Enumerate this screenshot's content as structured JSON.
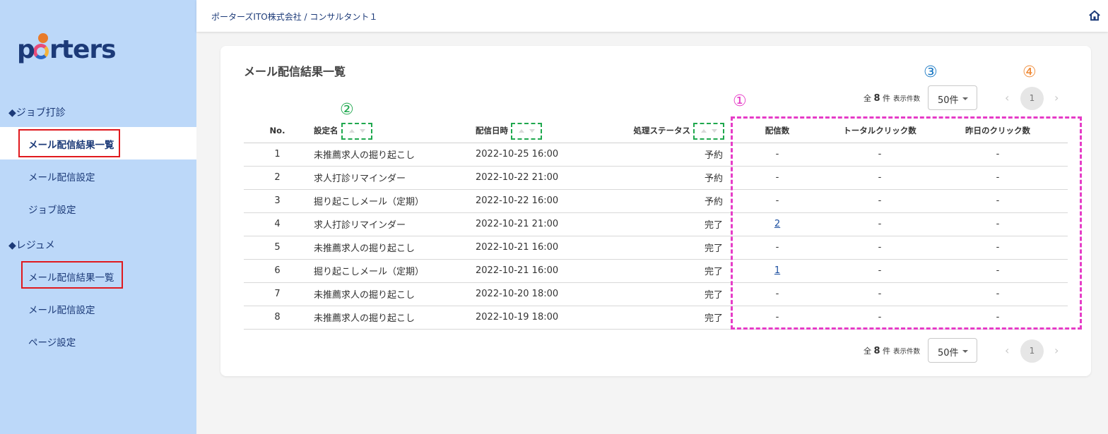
{
  "sidebar": {
    "logo_text": "porters",
    "sections": [
      {
        "heading": "◆ジョブ打診",
        "items": [
          "メール配信結果一覧",
          "メール配信設定",
          "ジョブ設定"
        ]
      },
      {
        "heading": "◆レジュメ",
        "items": [
          "メール配信結果一覧",
          "メール配信設定",
          "ページ設定"
        ]
      }
    ]
  },
  "header": {
    "breadcrumb": "ポーターズITO株式会社 / コンサルタント１"
  },
  "main": {
    "title": "メール配信結果一覧",
    "pager": {
      "total_prefix": "全",
      "total_count": "8",
      "total_suffix": "件",
      "per_page_label": "表示件数",
      "per_page_value": "50件",
      "prev": "‹",
      "current_page": "1",
      "next": "›"
    },
    "columns": [
      "No.",
      "設定名",
      "配信日時",
      "処理ステータス",
      "配信数",
      "トータルクリック数",
      "昨日のクリック数"
    ],
    "rows": [
      [
        "1",
        "未推薦求人の掘り起こし",
        "2022-10-25 16:00",
        "予約",
        "-",
        "-",
        "-"
      ],
      [
        "2",
        "求人打診リマインダー",
        "2022-10-22 21:00",
        "予約",
        "-",
        "-",
        "-"
      ],
      [
        "3",
        "掘り起こしメール（定期）",
        "2022-10-22 16:00",
        "予約",
        "-",
        "-",
        "-"
      ],
      [
        "4",
        "求人打診リマインダー",
        "2022-10-21 21:00",
        "完了",
        "2",
        "-",
        "-"
      ],
      [
        "5",
        "未推薦求人の掘り起こし",
        "2022-10-21 16:00",
        "完了",
        "-",
        "-",
        "-"
      ],
      [
        "6",
        "掘り起こしメール（定期）",
        "2022-10-21 16:00",
        "完了",
        "1",
        "-",
        "-"
      ],
      [
        "7",
        "未推薦求人の掘り起こし",
        "2022-10-20 18:00",
        "完了",
        "-",
        "-",
        "-"
      ],
      [
        "8",
        "未推薦求人の掘り起こし",
        "2022-10-19 18:00",
        "完了",
        "-",
        "-",
        "-"
      ]
    ]
  },
  "annotations": {
    "n1": "①",
    "n2": "②",
    "n3": "③",
    "n4": "④",
    "colors": {
      "n1": "#e63cc7",
      "n2": "#1fa84e",
      "n3": "#1b79c4",
      "n4": "#f08c3a",
      "highlight_box": "#e0191e"
    }
  },
  "icons": {
    "home": "home-icon",
    "sort": "sort-arrows-icon",
    "caret": "caret-down-icon"
  }
}
